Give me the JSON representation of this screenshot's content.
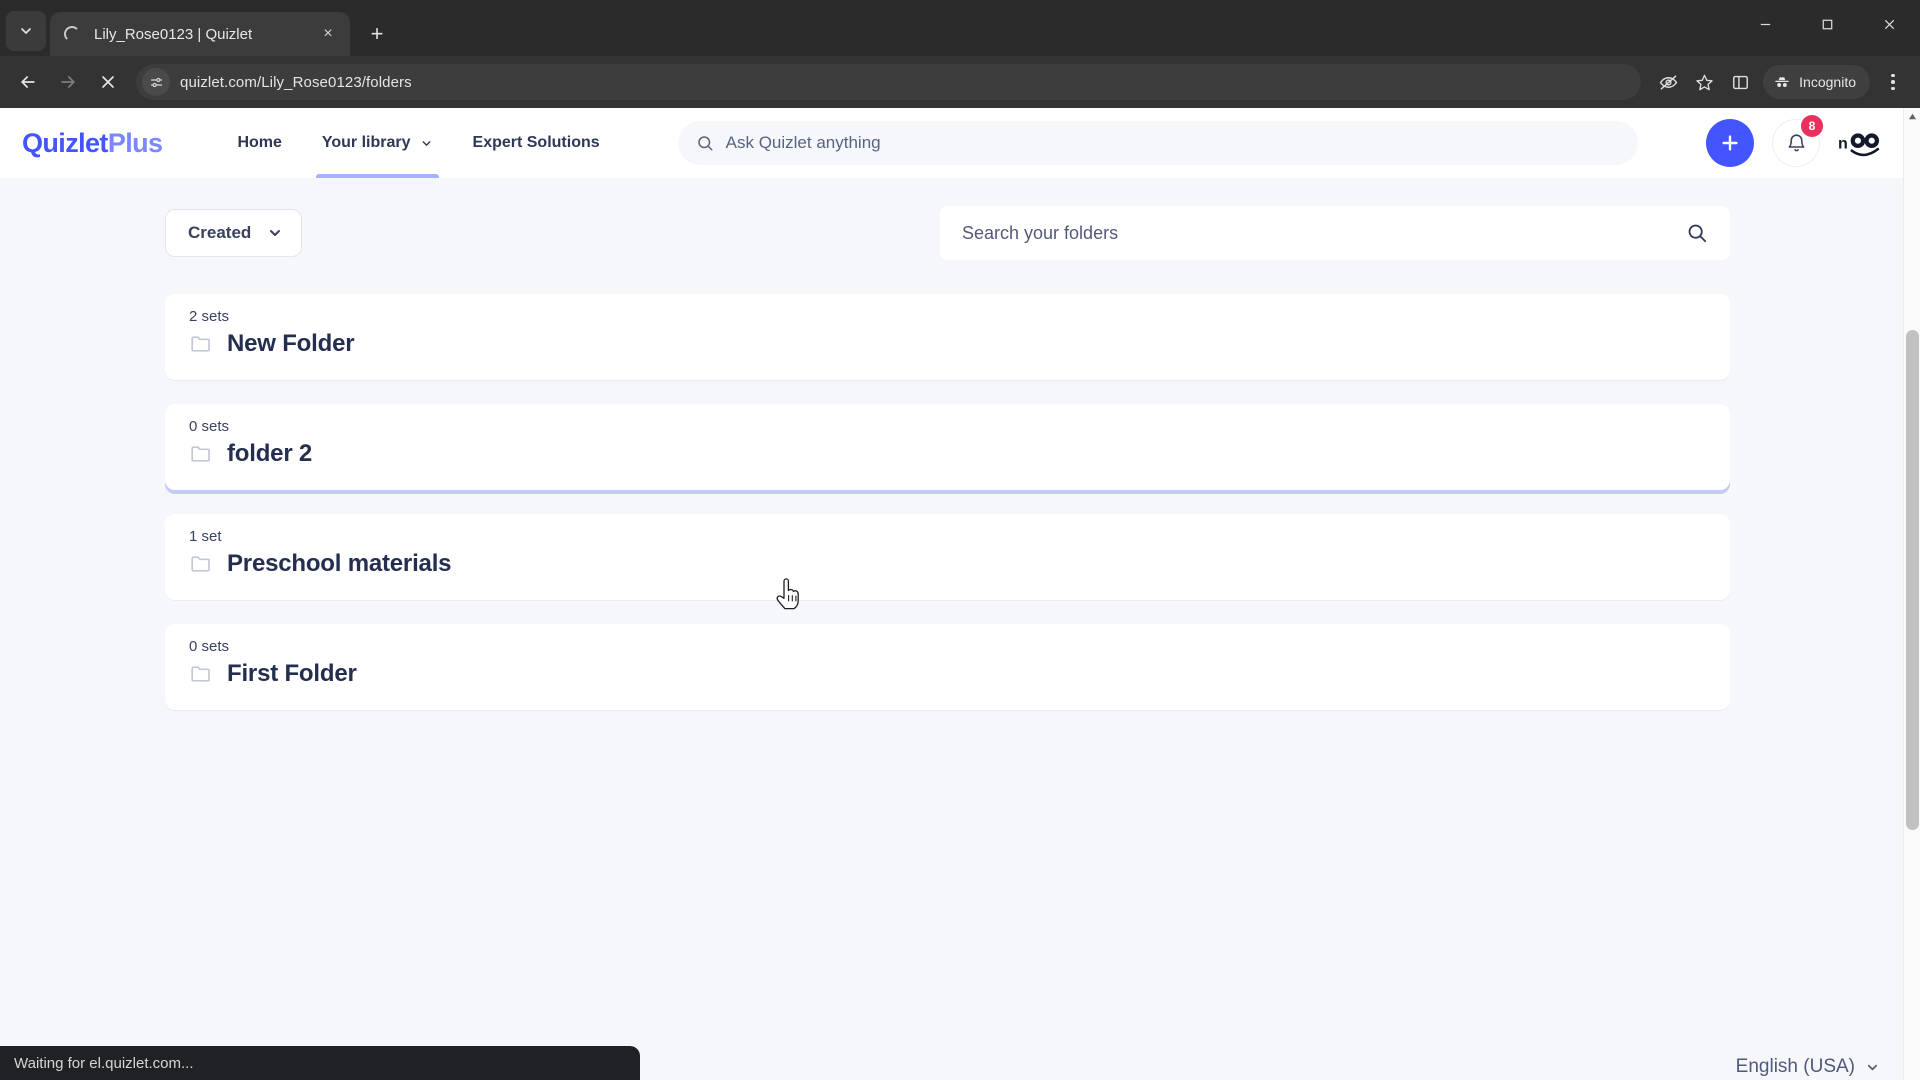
{
  "browser": {
    "tab": {
      "title": "Lily_Rose0123 | Quizlet",
      "close_label": "×",
      "loading": true
    },
    "new_tab_label": "+",
    "url": "quizlet.com/Lily_Rose0123/folders",
    "incognito_label": "Incognito",
    "status_text": "Waiting for el.quizlet.com...",
    "window_controls": {
      "minimize": "minimize",
      "maximize": "maximize",
      "close": "close"
    }
  },
  "header": {
    "logo": {
      "primary": "Quizlet",
      "suffix": "Plus"
    },
    "nav": [
      {
        "label": "Home",
        "has_chevron": false,
        "active": false
      },
      {
        "label": "Your library",
        "has_chevron": true,
        "active": true
      },
      {
        "label": "Expert Solutions",
        "has_chevron": false,
        "active": false
      }
    ],
    "search_placeholder": "Ask Quizlet anything",
    "create_button_label": "+",
    "notification_count": "8"
  },
  "toolbar": {
    "sort_label": "Created",
    "folder_search_placeholder": "Search your folders"
  },
  "folders": [
    {
      "sets": "2 sets",
      "name": "New Folder",
      "hovered": false
    },
    {
      "sets": "0 sets",
      "name": "folder 2",
      "hovered": true
    },
    {
      "sets": "1 set",
      "name": "Preschool materials",
      "hovered": false
    },
    {
      "sets": "0 sets",
      "name": "First Folder",
      "hovered": false
    }
  ],
  "footer": {
    "language": "English (USA)"
  },
  "colors": {
    "brand_blue": "#4255ff",
    "brand_blue_light": "#7b86ff",
    "hover_underline": "#c6cbf5",
    "nav_active_underline": "#a8b1ff",
    "badge_red": "#e8315c",
    "page_bg": "#f6f7fb",
    "card_bg": "#ffffff",
    "title_text": "#242e4e"
  }
}
